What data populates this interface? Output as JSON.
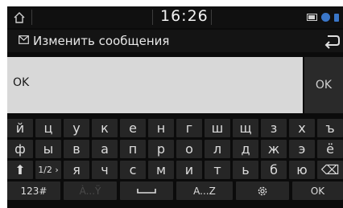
{
  "status_bar": {
    "time": "16:26",
    "icons": [
      "home-icon",
      "battery-icon",
      "bluetooth-icon",
      "signal-icon"
    ]
  },
  "title_bar": {
    "title": "Изменить сообщения",
    "icons": [
      "mail-icon",
      "back-arrow-icon"
    ]
  },
  "input": {
    "value": "OK"
  },
  "side_button": {
    "label": "OK"
  },
  "keyboard": {
    "rows": [
      [
        "й",
        "ц",
        "у",
        "к",
        "е",
        "н",
        "г",
        "ш",
        "щ",
        "з",
        "х",
        "ъ"
      ],
      [
        "ф",
        "ы",
        "в",
        "а",
        "п",
        "р",
        "о",
        "л",
        "д",
        "ж",
        "э",
        "ё"
      ],
      [
        "⬆",
        "1/2 ›",
        "я",
        "ч",
        "с",
        "м",
        "и",
        "т",
        "ь",
        "б",
        "ю",
        "⌫"
      ]
    ],
    "bottom_row": {
      "numbers": "123#",
      "accents": "À...Ÿ",
      "space": "",
      "latin": "A...Z",
      "settings": "settings-icon",
      "ok": "OK"
    }
  },
  "colors": {
    "screen_bg": "#0b0b0b",
    "key_bg": "#262626",
    "input_bg": "#d8d8d8",
    "accent_blue": "#3a76c8"
  }
}
